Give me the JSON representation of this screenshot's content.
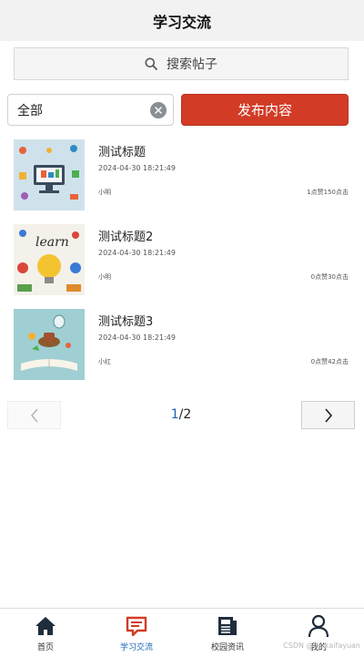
{
  "header": {
    "title": "学习交流"
  },
  "search": {
    "label": "搜索帖子"
  },
  "filter": {
    "selected": "全部",
    "publish_label": "发布内容"
  },
  "posts": [
    {
      "title": "测试标题",
      "date": "2024-04-30 18:21:49",
      "author": "小明",
      "stats": "1点赞150点击",
      "image": "computer-icons-illustration"
    },
    {
      "title": "测试标题2",
      "date": "2024-04-30 18:21:49",
      "author": "小明",
      "stats": "0点赞30点击",
      "image": "learn-lightbulb-illustration"
    },
    {
      "title": "测试标题3",
      "date": "2024-04-30 18:21:49",
      "author": "小红",
      "stats": "0点赞42点击",
      "image": "open-book-illustration"
    }
  ],
  "pagination": {
    "current": "1",
    "total": "/2"
  },
  "tabbar": [
    {
      "label": "首页",
      "icon": "home-icon",
      "active": false
    },
    {
      "label": "学习交流",
      "icon": "chat-icon",
      "active": true
    },
    {
      "label": "校园资讯",
      "icon": "newspaper-icon",
      "active": false
    },
    {
      "label": "我的",
      "icon": "user-icon",
      "active": false
    }
  ],
  "watermark": "CSDN @vx-kaifayuan",
  "colors": {
    "accent": "#d23b26",
    "active_tab": "#1a63b7",
    "header_bg": "#f2f2f2"
  }
}
